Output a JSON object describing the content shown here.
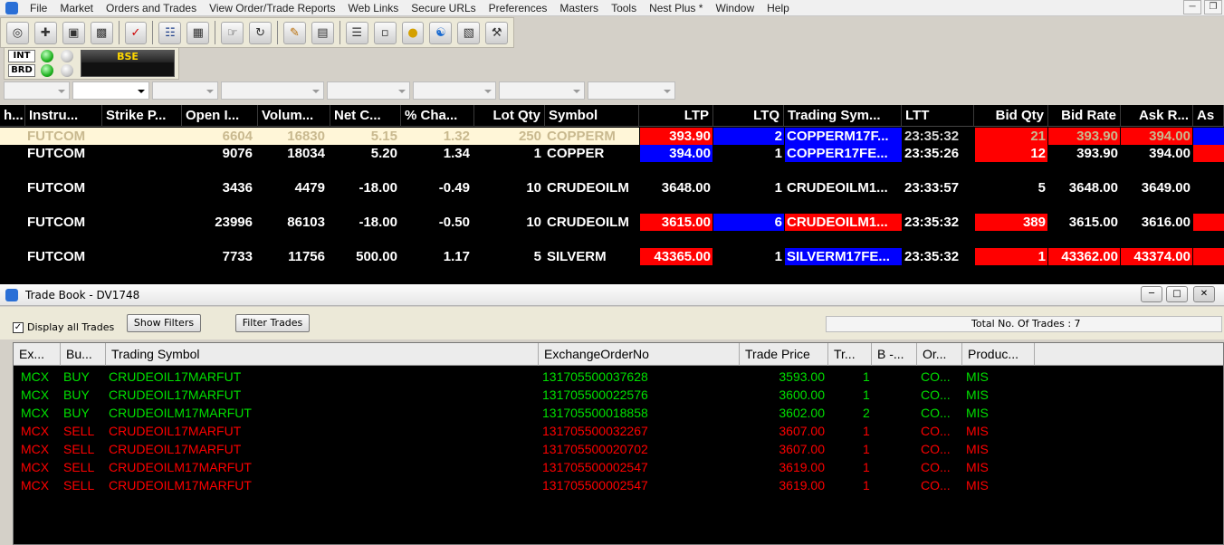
{
  "menu": [
    "File",
    "Market",
    "Orders and Trades",
    "View Order/Trade Reports",
    "Web Links",
    "Secure URLs",
    "Preferences",
    "Masters",
    "Tools",
    "Nest Plus *",
    "Window",
    "Help"
  ],
  "toolbar_icons": [
    "binoculars-icon",
    "plus-chart-icon",
    "add-window-icon",
    "monitor-icon",
    "checklist-icon",
    "book-icon",
    "grid-icon",
    "hand-icon",
    "refresh-icon",
    "notepad-icon",
    "report-icon",
    "document-icon",
    "form-icon",
    "coins-icon",
    "network-icon",
    "calculator-icon",
    "tools-icon"
  ],
  "conn": {
    "int": "INT",
    "brd": "BRD",
    "exchange": "BSE"
  },
  "market_watch": {
    "headers": [
      "h...",
      "Instru...",
      "Strike P...",
      "Open I...",
      "Volum...",
      "Net C...",
      "% Cha...",
      "Lot Qty",
      "Symbol",
      "LTP",
      "LTQ",
      "Trading Sym...",
      "LTT",
      "Bid Qty",
      "Bid Rate",
      "Ask R...",
      "As"
    ],
    "rows": [
      {
        "instr": "FUTCOM",
        "oi": "6604",
        "vol": "16830",
        "netc": "5.15",
        "pct": "1.32",
        "lot": "250",
        "sym": "COPPERM",
        "ltp": "393.90",
        "ltq": "2",
        "tsym": "COPPERM17F...",
        "ltt": "23:35:32",
        "bidq": "21",
        "bidr": "393.90",
        "askr": "394.00"
      },
      {
        "instr": "FUTCOM",
        "oi": "9076",
        "vol": "18034",
        "netc": "5.20",
        "pct": "1.34",
        "lot": "1",
        "sym": "COPPER",
        "ltp": "394.00",
        "ltq": "1",
        "tsym": "COPPER17FE...",
        "ltt": "23:35:26",
        "bidq": "12",
        "bidr": "393.90",
        "askr": "394.00"
      },
      {
        "instr": "FUTCOM",
        "oi": "3436",
        "vol": "4479",
        "netc": "-18.00",
        "pct": "-0.49",
        "lot": "10",
        "sym": "CRUDEOILM",
        "ltp": "3648.00",
        "ltq": "1",
        "tsym": "CRUDEOILM1...",
        "ltt": "23:33:57",
        "bidq": "5",
        "bidr": "3648.00",
        "askr": "3649.00"
      },
      {
        "instr": "FUTCOM",
        "oi": "23996",
        "vol": "86103",
        "netc": "-18.00",
        "pct": "-0.50",
        "lot": "10",
        "sym": "CRUDEOILM",
        "ltp": "3615.00",
        "ltq": "6",
        "tsym": "CRUDEOILM1...",
        "ltt": "23:35:32",
        "bidq": "389",
        "bidr": "3615.00",
        "askr": "3616.00"
      },
      {
        "instr": "FUTCOM",
        "oi": "7733",
        "vol": "11756",
        "netc": "500.00",
        "pct": "1.17",
        "lot": "5",
        "sym": "SILVERM",
        "ltp": "43365.00",
        "ltq": "1",
        "tsym": "SILVERM17FE...",
        "ltt": "23:35:32",
        "bidq": "1",
        "bidr": "43362.00",
        "askr": "43374.00"
      }
    ]
  },
  "trade_book": {
    "title": "Trade Book - DV1748",
    "display_all_label": "Display all Trades",
    "show_filters": "Show Filters",
    "filter_trades": "Filter Trades",
    "total": "Total No. Of Trades : 7",
    "headers": [
      "Ex...",
      "Bu...",
      "Trading Symbol",
      "ExchangeOrderNo",
      "Trade Price",
      "Tr...",
      "B -...",
      "Or...",
      "Produc..."
    ],
    "rows": [
      {
        "ex": "MCX",
        "side": "BUY",
        "symbol": "CRUDEOIL17MARFUT",
        "order": "131705500037628",
        "price": "3593.00",
        "qty": "1",
        "b": "",
        "or": "CO...",
        "prod": "MIS"
      },
      {
        "ex": "MCX",
        "side": "BUY",
        "symbol": "CRUDEOIL17MARFUT",
        "order": "131705500022576",
        "price": "3600.00",
        "qty": "1",
        "b": "",
        "or": "CO...",
        "prod": "MIS"
      },
      {
        "ex": "MCX",
        "side": "BUY",
        "symbol": "CRUDEOILM17MARFUT",
        "order": "131705500018858",
        "price": "3602.00",
        "qty": "2",
        "b": "",
        "or": "CO...",
        "prod": "MIS"
      },
      {
        "ex": "MCX",
        "side": "SELL",
        "symbol": "CRUDEOIL17MARFUT",
        "order": "131705500032267",
        "price": "3607.00",
        "qty": "1",
        "b": "",
        "or": "CO...",
        "prod": "MIS"
      },
      {
        "ex": "MCX",
        "side": "SELL",
        "symbol": "CRUDEOIL17MARFUT",
        "order": "131705500020702",
        "price": "3607.00",
        "qty": "1",
        "b": "",
        "or": "CO...",
        "prod": "MIS"
      },
      {
        "ex": "MCX",
        "side": "SELL",
        "symbol": "CRUDEOILM17MARFUT",
        "order": "131705500002547",
        "price": "3619.00",
        "qty": "1",
        "b": "",
        "or": "CO...",
        "prod": "MIS"
      },
      {
        "ex": "MCX",
        "side": "SELL",
        "symbol": "CRUDEOILM17MARFUT",
        "order": "131705500002547",
        "price": "3619.00",
        "qty": "1",
        "b": "",
        "or": "CO...",
        "prod": "MIS"
      }
    ]
  },
  "colors": {
    "buy": "#00e000",
    "sell": "#ff0000",
    "up_bg": "#0000ff",
    "down_bg": "#ff0000",
    "selected_row": "#fff6d8"
  }
}
